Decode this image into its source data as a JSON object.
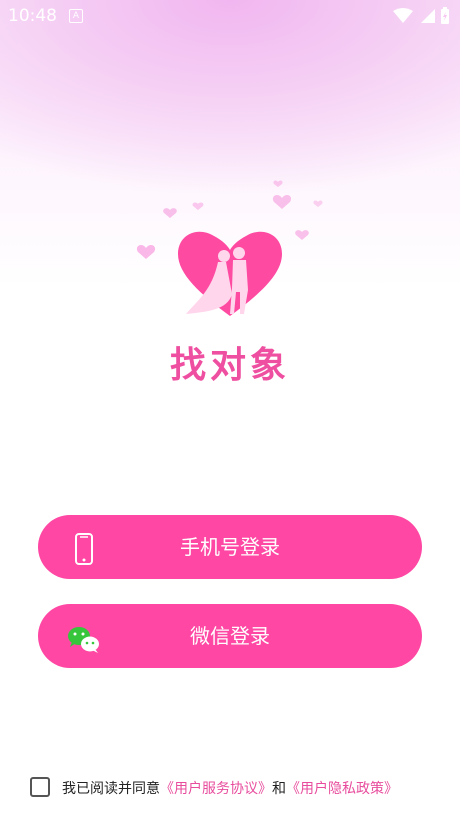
{
  "status_bar": {
    "time": "10:48",
    "notification_icon": "A"
  },
  "app": {
    "name": "找对象"
  },
  "buttons": {
    "phone_login": "手机号登录",
    "wechat_login": "微信登录"
  },
  "agreement": {
    "prefix": "我已阅读并同意",
    "service_link": "《用户服务协议》",
    "conjunction": "和",
    "privacy_link": "《用户隐私政策》",
    "checked": false
  },
  "colors": {
    "accent": "#ff47a3",
    "link": "#e84d9d"
  }
}
